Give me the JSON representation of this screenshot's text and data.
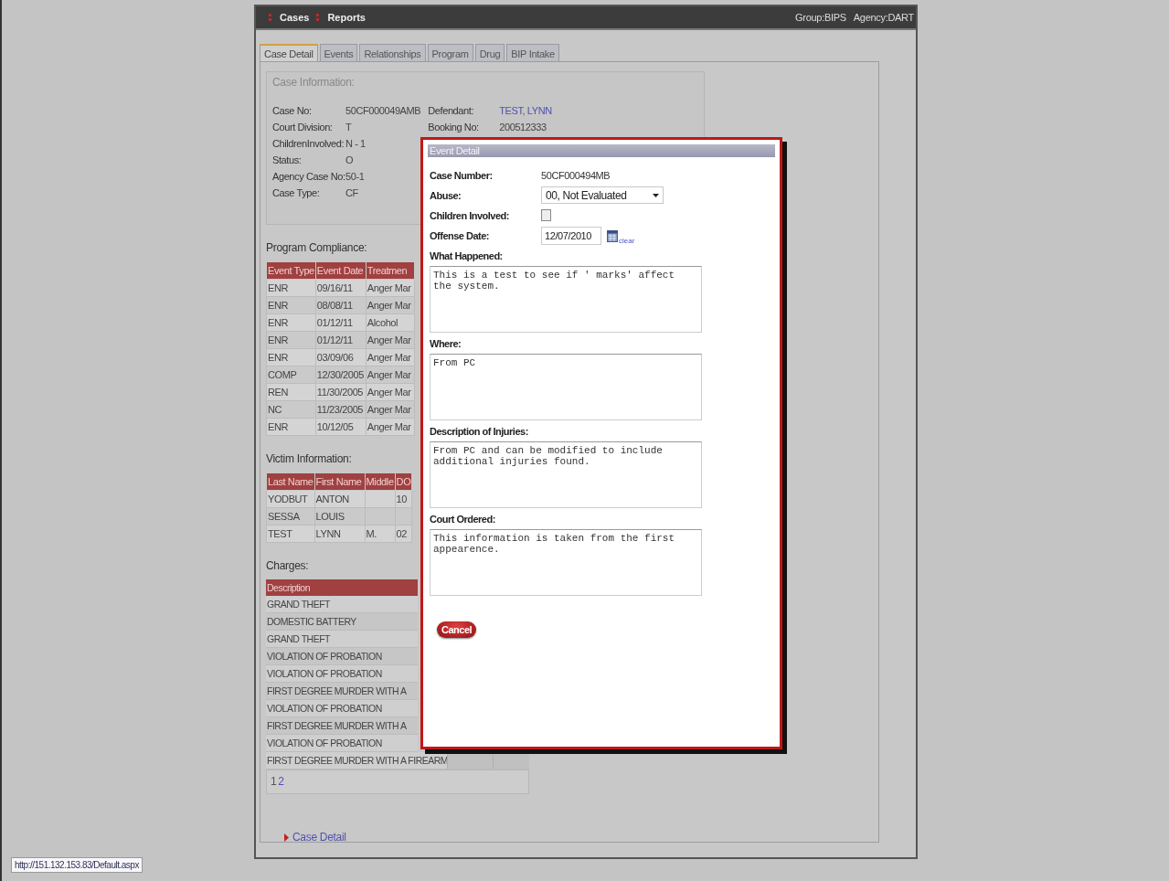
{
  "nav": {
    "items": [
      {
        "label": "Cases"
      },
      {
        "label": "Reports"
      }
    ],
    "group": "Group:BIPS",
    "agency": "Agency:DART"
  },
  "tabs": [
    {
      "label": "Case Detail",
      "selected": true
    },
    {
      "label": "Events",
      "selected": false
    },
    {
      "label": "Relationships",
      "selected": false
    },
    {
      "label": "Program",
      "selected": false
    },
    {
      "label": "Drug",
      "selected": false
    },
    {
      "label": "BIP Intake",
      "selected": false
    }
  ],
  "case_info": {
    "title": "Case Information:",
    "fields": [
      {
        "label": "Case No:",
        "value": "50CF000049AMB"
      },
      {
        "label": "Court Division:",
        "value": "T"
      },
      {
        "label": "ChildrenInvolved:",
        "value": "N - 1"
      },
      {
        "label": "Status:",
        "value": "O"
      },
      {
        "label": "Agency Case No:",
        "value": "50-1"
      },
      {
        "label": "Case Type:",
        "value": "CF"
      }
    ],
    "side_fields": [
      {
        "label": "Defendant:",
        "value": "TEST, LYNN",
        "kind": "link"
      },
      {
        "label": "Booking No:",
        "value": "200512333",
        "kind": "text"
      }
    ]
  },
  "program_compliance": {
    "title": "Program Compliance:",
    "columns": [
      "Event Type",
      "Event Date",
      "Treatmen"
    ],
    "rows": [
      [
        "ENR",
        "09/16/11",
        "Anger Mar"
      ],
      [
        "ENR",
        "08/08/11",
        "Anger Mar"
      ],
      [
        "ENR",
        "01/12/11",
        "Alcohol"
      ],
      [
        "ENR",
        "01/12/11",
        "Anger Mar"
      ],
      [
        "ENR",
        "03/09/06",
        "Anger Mar"
      ],
      [
        "COMP",
        "12/30/2005",
        "Anger Mar"
      ],
      [
        "REN",
        "11/30/2005",
        "Anger Mar"
      ],
      [
        "NC",
        "11/23/2005",
        "Anger Mar"
      ],
      [
        "ENR",
        "10/12/05",
        "Anger Mar"
      ]
    ]
  },
  "victim_information": {
    "title": "Victim Information:",
    "columns": [
      "Last Name",
      "First Name",
      "Middle",
      "DO"
    ],
    "rows": [
      {
        "last_name": "YODBUT",
        "first_name": "ANTON",
        "column_4": "10"
      },
      {
        "last_name": "SESSA",
        "first_name": "LOUIS"
      },
      {
        "last_name": "TEST",
        "first_name": "LYNN",
        "middle": "M.",
        "column_4": "02"
      }
    ]
  },
  "charges": {
    "title": "Charges:",
    "column": "Description",
    "rows": [
      "GRAND THEFT",
      "DOMESTIC BATTERY",
      "GRAND THEFT",
      "VIOLATION OF PROBATION",
      "VIOLATION OF PROBATION",
      "FIRST DEGREE MURDER WITH A",
      "VIOLATION OF PROBATION",
      "FIRST DEGREE MURDER WITH A",
      "VIOLATION OF PROBATION"
    ],
    "last_row": "FIRST DEGREE MURDER WITH A FIREARM",
    "pages": [
      {
        "label": "1",
        "selected": true
      },
      {
        "label": "2",
        "selected": false
      }
    ]
  },
  "footer_link": "Case Detail",
  "modal": {
    "title": "Event Detail",
    "case_number": {
      "label": "Case Number:",
      "value": "50CF000494MB"
    },
    "abuse": {
      "label": "Abuse:",
      "value": "00, Not Evaluated"
    },
    "children_involved": {
      "label": "Children Involved:",
      "checked": false
    },
    "offense_date": {
      "label": "Offense Date:",
      "value": "12/07/2010",
      "clear": "clear"
    },
    "text_areas": [
      {
        "label": "What Happened:",
        "value": "This is a test to see if ' marks' affect the system."
      },
      {
        "label": "Where:",
        "value": "From PC"
      },
      {
        "label": "Description of Injuries:",
        "value": "From PC and can be modified to include additional injuries found."
      },
      {
        "label": "Court Ordered:",
        "value": "This information is taken from the first appearence."
      }
    ],
    "cancel": "Cancel"
  },
  "status_url": "http://151.132.153.83/Default.aspx"
}
